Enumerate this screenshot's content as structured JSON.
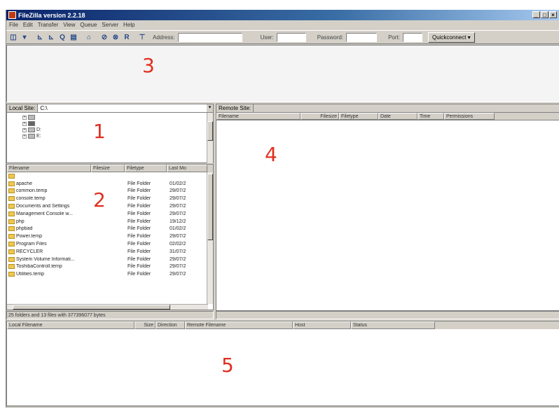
{
  "window": {
    "title": "FileZilla version 2.2.18"
  },
  "menu": [
    "File",
    "Edit",
    "Transfer",
    "View",
    "Queue",
    "Server",
    "Help"
  ],
  "toolbar": {
    "address_label": "Address:",
    "user_label": "User:",
    "password_label": "Password:",
    "port_label": "Port:",
    "connect_button": "Quickconnect"
  },
  "local": {
    "site_label": "Local Site:",
    "path": "C:\\",
    "drives": [
      "",
      "",
      "D:",
      "E:"
    ],
    "columns": [
      "Filename",
      "Filesize",
      "Filetype",
      "Last Mo"
    ],
    "files": [
      {
        "name": "",
        "type": "",
        "date": ""
      },
      {
        "name": "apache",
        "type": "File Folder",
        "date": "01/02/2"
      },
      {
        "name": "common.temp",
        "type": "File Folder",
        "date": "29/07/2"
      },
      {
        "name": "console.temp",
        "type": "File Folder",
        "date": "29/07/2"
      },
      {
        "name": "Documents and Settings",
        "type": "File Folder",
        "date": "29/07/2"
      },
      {
        "name": "Management Console w...",
        "type": "File Folder",
        "date": "29/07/2"
      },
      {
        "name": "php",
        "type": "File Folder",
        "date": "19/12/2"
      },
      {
        "name": "phpbad",
        "type": "File Folder",
        "date": "01/02/2"
      },
      {
        "name": "Power.temp",
        "type": "File Folder",
        "date": "29/07/2"
      },
      {
        "name": "Program Files",
        "type": "File Folder",
        "date": "02/02/2"
      },
      {
        "name": "RECYCLER",
        "type": "File Folder",
        "date": "31/07/2"
      },
      {
        "name": "System Volume Informati...",
        "type": "File Folder",
        "date": "29/07/2"
      },
      {
        "name": "ToshibaControll.temp",
        "type": "File Folder",
        "date": "29/07/2"
      },
      {
        "name": "Utilities.temp",
        "type": "File Folder",
        "date": "29/07/2"
      }
    ],
    "status": "25 folders and 13 files with 377396077 bytes"
  },
  "remote": {
    "site_label": "Remote Site:",
    "columns": [
      "Filename",
      "Filesize",
      "Filetype",
      "Date",
      "Time",
      "Permissions"
    ]
  },
  "queue": {
    "columns": [
      "Local Filename",
      "Size",
      "Direction",
      "Remote Filename",
      "Host",
      "Status"
    ]
  },
  "markers": [
    "1",
    "2",
    "3",
    "4",
    "5"
  ],
  "colors": {
    "title_bar": "#0a246a",
    "marker": "#e03020",
    "folder": "#f0c850",
    "chrome": "#d4d0c8"
  }
}
